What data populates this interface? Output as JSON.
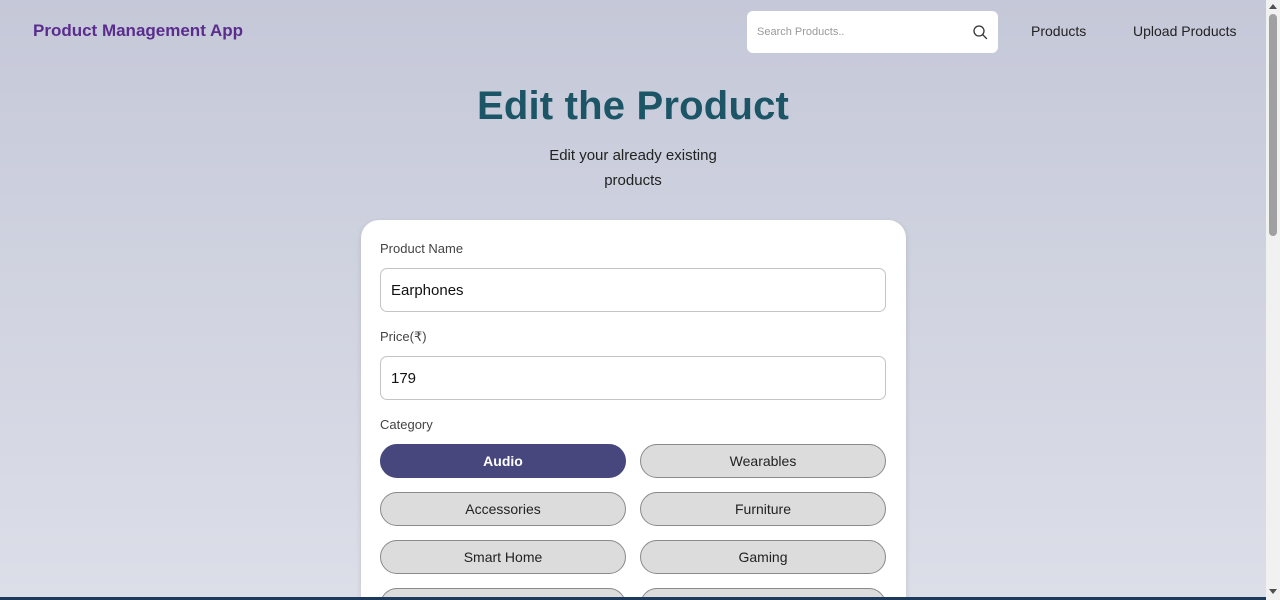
{
  "navbar": {
    "brand": "Product Management App",
    "search_placeholder": "Search Products..",
    "links": [
      "Products",
      "Upload Products"
    ]
  },
  "header": {
    "title": "Edit the Product",
    "subtitle": "Edit your already existing products"
  },
  "form": {
    "name_label": "Product Name",
    "name_value": "Earphones",
    "price_label": "Price(₹)",
    "price_value": "179",
    "category_label": "Category",
    "categories": [
      "Audio",
      "Wearables",
      "Accessories",
      "Furniture",
      "Smart Home",
      "Gaming"
    ],
    "selected_category": "Audio"
  },
  "colors": {
    "brand": "#5a2d8c",
    "title": "#1c5566",
    "active_category": "#47477e"
  },
  "icons": {
    "search": "search-icon"
  }
}
